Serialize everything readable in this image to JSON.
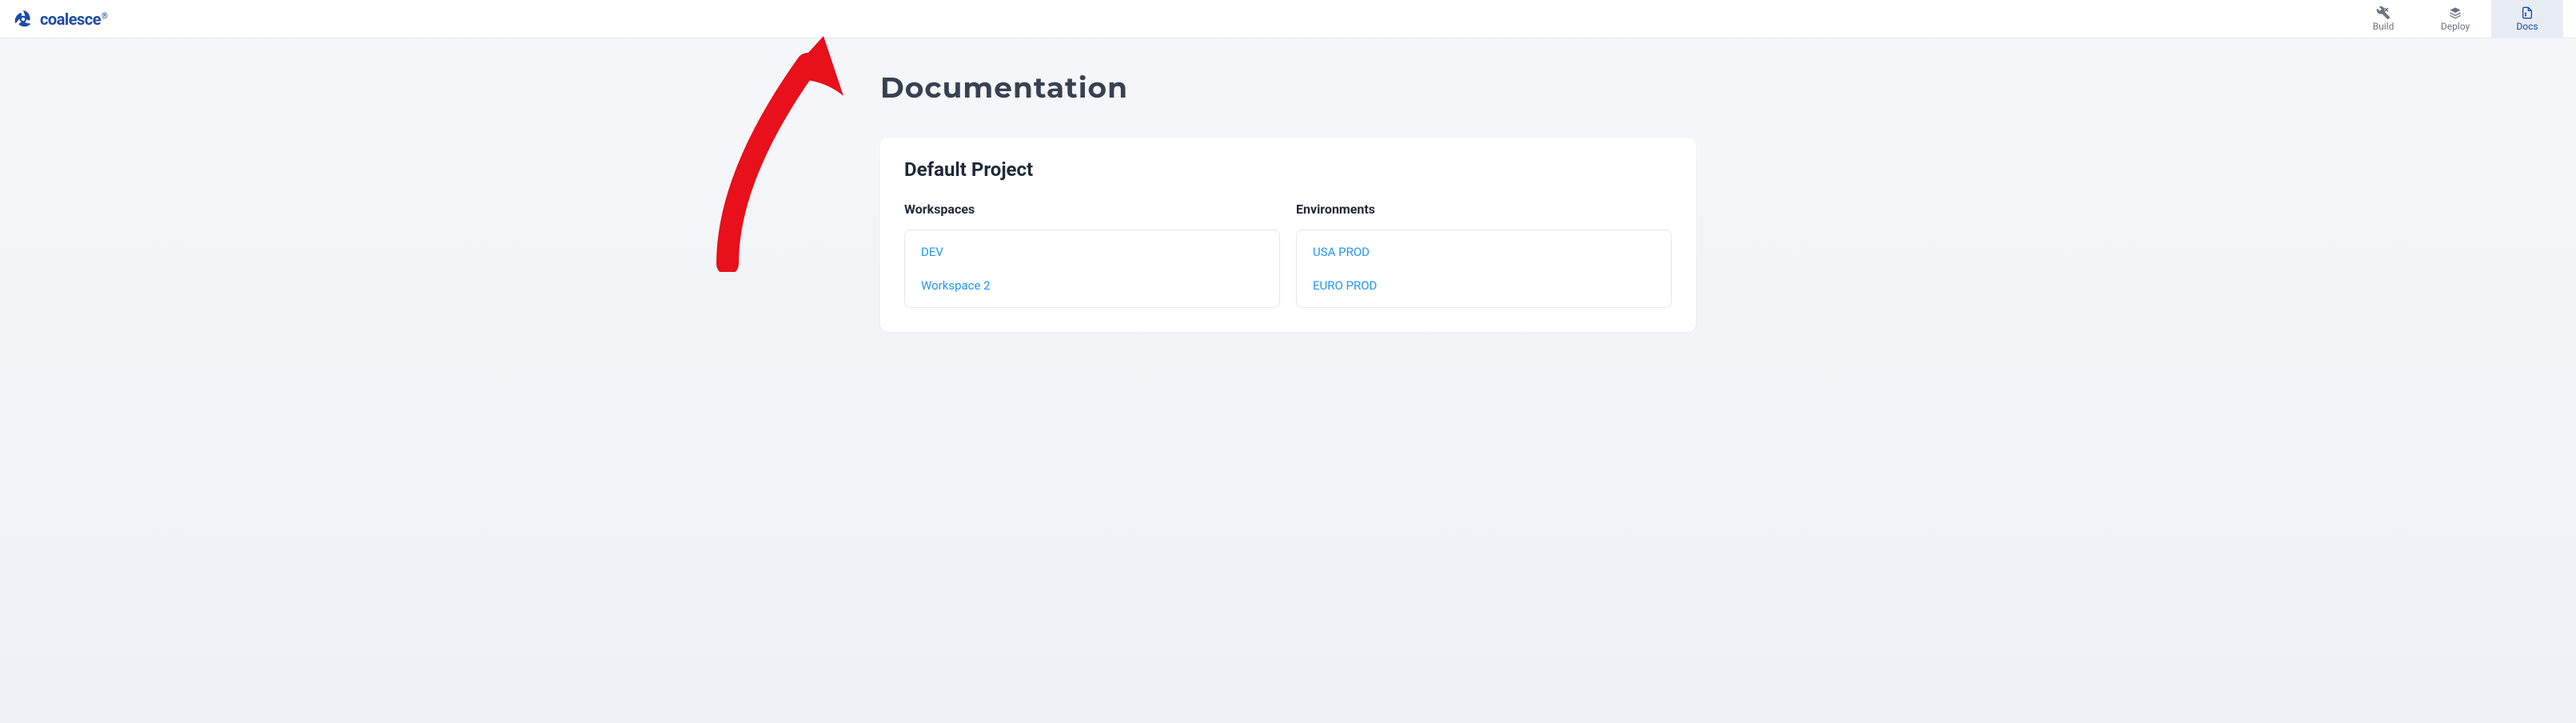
{
  "brand": {
    "name": "coalesce"
  },
  "nav": {
    "tabs": [
      {
        "label": "Build",
        "icon": "wrench-icon",
        "active": false
      },
      {
        "label": "Deploy",
        "icon": "deploy-icon",
        "active": false
      },
      {
        "label": "Docs",
        "icon": "docs-icon",
        "active": true
      }
    ]
  },
  "page": {
    "title": "Documentation"
  },
  "project": {
    "name": "Default Project",
    "workspaces_label": "Workspaces",
    "environments_label": "Environments",
    "workspaces": [
      {
        "name": "DEV"
      },
      {
        "name": "Workspace 2"
      }
    ],
    "environments": [
      {
        "name": "USA PROD"
      },
      {
        "name": "EURO PROD"
      }
    ]
  }
}
